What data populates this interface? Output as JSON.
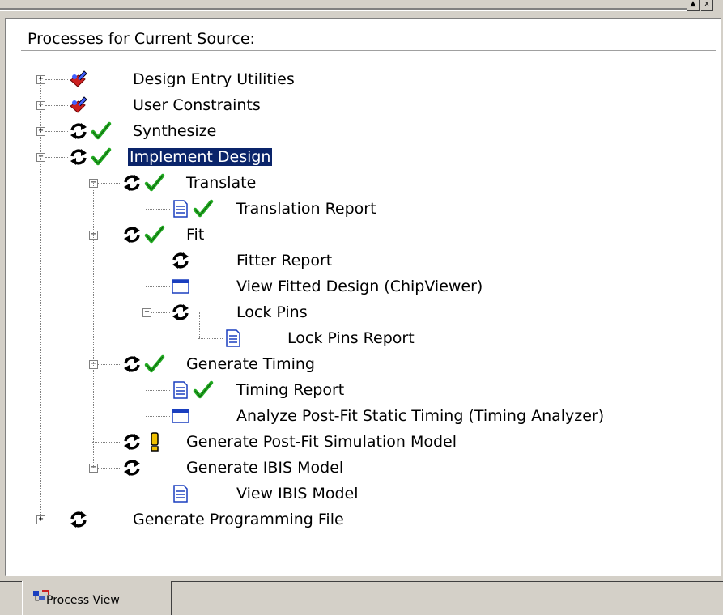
{
  "panel": {
    "header": "Processes for Current Source:"
  },
  "tree": [
    {
      "label": "Design Entry Utilities",
      "exp": "+",
      "icons": [
        "tools"
      ]
    },
    {
      "label": "User Constraints",
      "exp": "+",
      "icons": [
        "tools"
      ]
    },
    {
      "label": "Synthesize",
      "exp": "+",
      "icons": [
        "process",
        "check"
      ]
    },
    {
      "label": "Implement Design",
      "exp": "-",
      "icons": [
        "process",
        "check"
      ],
      "selected": true
    },
    {
      "label": "Translate",
      "exp": "-",
      "icons": [
        "process",
        "check"
      ]
    },
    {
      "label": "Translation Report",
      "exp": "",
      "icons": [
        "report",
        "check"
      ]
    },
    {
      "label": "Fit",
      "exp": "-",
      "icons": [
        "process",
        "check"
      ]
    },
    {
      "label": "Fitter Report",
      "exp": "",
      "icons": [
        "process"
      ]
    },
    {
      "label": "View Fitted Design (ChipViewer)",
      "exp": "",
      "icons": [
        "window"
      ]
    },
    {
      "label": "Lock Pins",
      "exp": "-",
      "icons": [
        "process"
      ]
    },
    {
      "label": "Lock Pins Report",
      "exp": "",
      "icons": [
        "report"
      ]
    },
    {
      "label": "Generate Timing",
      "exp": "-",
      "icons": [
        "process",
        "check"
      ]
    },
    {
      "label": "Timing Report",
      "exp": "",
      "icons": [
        "report",
        "check"
      ]
    },
    {
      "label": "Analyze Post-Fit Static Timing (Timing Analyzer)",
      "exp": "",
      "icons": [
        "window"
      ]
    },
    {
      "label": "Generate Post-Fit Simulation Model",
      "exp": "",
      "icons": [
        "process",
        "warning"
      ]
    },
    {
      "label": "Generate IBIS Model",
      "exp": "-",
      "icons": [
        "process"
      ]
    },
    {
      "label": "View IBIS Model",
      "exp": "",
      "icons": [
        "report"
      ]
    },
    {
      "label": "Generate Programming File",
      "exp": "+",
      "icons": [
        "process"
      ]
    }
  ],
  "tabs": [
    {
      "label": "Process View",
      "icon": "process-view-icon"
    }
  ],
  "window_buttons": [
    "▲",
    "x"
  ],
  "colors": {
    "selection": "#0a246a",
    "check": "#22aa22",
    "tools": "#cc2020",
    "report": "#1a3fbf"
  }
}
